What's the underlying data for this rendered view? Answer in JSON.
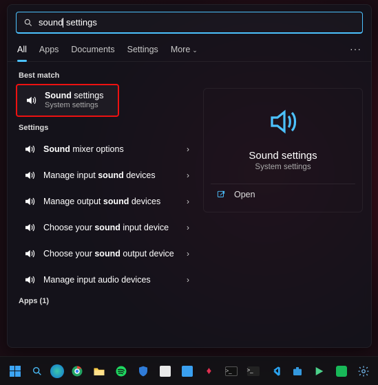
{
  "search": {
    "prefix": "sound",
    "suffix": " settings"
  },
  "tabs": {
    "all": "All",
    "apps": "Apps",
    "documents": "Documents",
    "settings": "Settings",
    "more": "More"
  },
  "groups": {
    "best_match": "Best match",
    "settings": "Settings",
    "apps_count_label": "Apps (1)"
  },
  "best": {
    "title_bold": "Sound",
    "title_rest": " settings",
    "sub": "System settings"
  },
  "settings_items": [
    {
      "pre": "",
      "bold": "Sound",
      "post": " mixer options"
    },
    {
      "pre": "Manage input ",
      "bold": "sound",
      "post": " devices"
    },
    {
      "pre": "Manage output ",
      "bold": "sound",
      "post": " devices"
    },
    {
      "pre": "Choose your ",
      "bold": "sound",
      "post": " input device"
    },
    {
      "pre": "Choose your ",
      "bold": "sound",
      "post": " output device"
    },
    {
      "pre": "Manage input audio devices",
      "bold": "",
      "post": ""
    }
  ],
  "preview": {
    "title": "Sound settings",
    "sub": "System settings",
    "open": "Open"
  },
  "colors": {
    "accent": "#4cc2ff",
    "highlight_border": "#e11"
  },
  "taskbar": [
    "start",
    "search",
    "edge",
    "chrome",
    "files",
    "spotify",
    "security",
    "mail",
    "devil",
    "terminal",
    "winterm",
    "vscode",
    "store",
    "play",
    "xbox",
    "settings"
  ]
}
